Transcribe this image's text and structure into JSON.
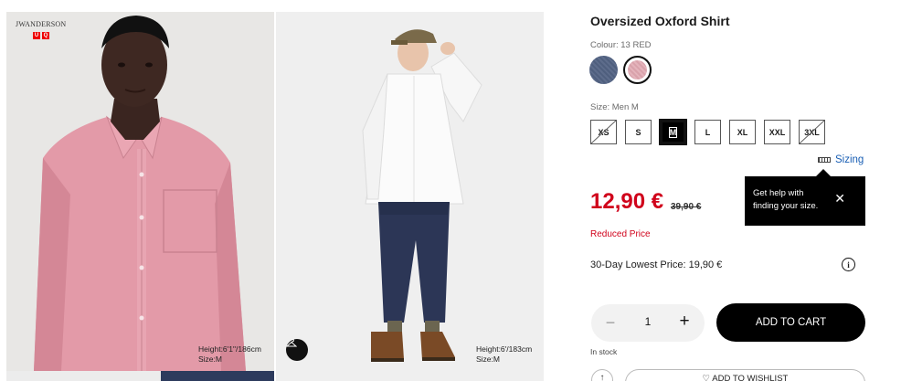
{
  "gallery": {
    "brand_text": "JWANDERSON",
    "brand_logo": [
      "U",
      "Q"
    ],
    "photo1_caption": [
      "Height:6'1\"/186cm",
      "Size:M"
    ],
    "photo2_caption": [
      "Height:6'/183cm",
      "Size:M"
    ],
    "hanger_icon": "hanger-icon"
  },
  "product": {
    "title": "Oversized Oxford Shirt",
    "colour_label": "Colour: 13 RED",
    "colours": [
      {
        "name": "navy",
        "hex": "#56668a"
      },
      {
        "name": "red",
        "hex": "#dda9b2",
        "selected": true
      }
    ],
    "size_label": "Size: Men M",
    "sizes": [
      {
        "label": "XS",
        "available": false
      },
      {
        "label": "S",
        "available": true
      },
      {
        "label": "M",
        "available": true,
        "selected": true
      },
      {
        "label": "L",
        "available": true
      },
      {
        "label": "XL",
        "available": true
      },
      {
        "label": "XXL",
        "available": true
      },
      {
        "label": "3XL",
        "available": false
      }
    ],
    "sizing_link": "Sizing",
    "tooltip": {
      "line1": "Get help with",
      "line2": "finding your size."
    },
    "price": "12,90 €",
    "old_price": "39,90 €",
    "reduced_label": "Reduced Price",
    "lowest_price": "30-Day Lowest Price: 19,90 €",
    "quantity": "1",
    "add_to_cart": "ADD TO CART",
    "stock": "In stock",
    "wishlist": "♡ ADD TO WISHLIST"
  },
  "colors": {
    "price_red": "#d0021b",
    "link_blue": "#1a5fb4",
    "button_black": "#000000"
  }
}
